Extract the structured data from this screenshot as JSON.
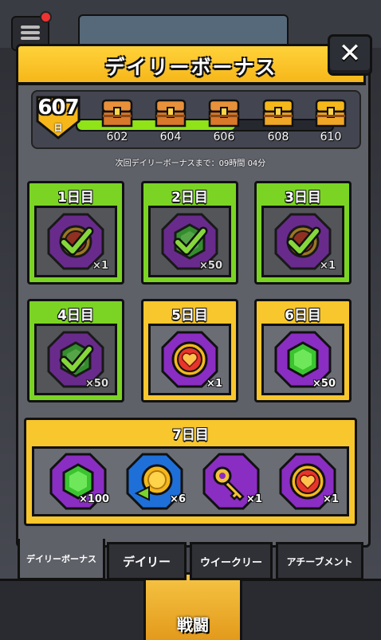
{
  "header": {
    "title": "デイリーボーナス",
    "close_label": "✕"
  },
  "background": {
    "battle_label": "戦闘"
  },
  "progress": {
    "current_day": "607",
    "day_unit": "日",
    "fraction_filled": 0.62,
    "milestones": [
      {
        "label": "602",
        "state": "opened"
      },
      {
        "label": "604",
        "state": "opened"
      },
      {
        "label": "606",
        "state": "opened"
      },
      {
        "label": "608",
        "state": "locked"
      },
      {
        "label": "610",
        "state": "locked"
      }
    ]
  },
  "next_bonus": "次回デイリーボーナスまで：09時間 04分",
  "days": [
    {
      "title": "1日目",
      "item": "token-icon",
      "qty": "×1",
      "claimed": true,
      "theme": "green"
    },
    {
      "title": "2日目",
      "item": "gem-icon",
      "qty": "×50",
      "claimed": true,
      "theme": "green"
    },
    {
      "title": "3日目",
      "item": "token-icon",
      "qty": "×1",
      "claimed": true,
      "theme": "green"
    },
    {
      "title": "4日目",
      "item": "gem-icon",
      "qty": "×50",
      "claimed": true,
      "theme": "green"
    },
    {
      "title": "5日目",
      "item": "heart-token-icon",
      "qty": "×1",
      "claimed": false,
      "theme": "yellow"
    },
    {
      "title": "6日目",
      "item": "gem-icon",
      "qty": "×50",
      "claimed": false,
      "theme": "yellow"
    }
  ],
  "day7": {
    "title": "7日目",
    "rewards": [
      {
        "item": "gem-icon",
        "qty": "×100"
      },
      {
        "item": "coin-arrow-icon",
        "qty": "×6"
      },
      {
        "item": "key-icon",
        "qty": "×1"
      },
      {
        "item": "heart-token-icon",
        "qty": "×1"
      }
    ]
  },
  "tabs": [
    {
      "label": "デイリーボーナス",
      "active": true
    },
    {
      "label": "デイリー",
      "active": false
    },
    {
      "label": "ウイークリー",
      "active": false
    },
    {
      "label": "アチーブメント",
      "active": false
    }
  ],
  "colors": {
    "header": "#f6b71a",
    "day_claimed": "#7bd424",
    "day_pending": "#f8c62d",
    "progress_fill": "#8fe317",
    "reward_purple": "#8a2dc2"
  }
}
